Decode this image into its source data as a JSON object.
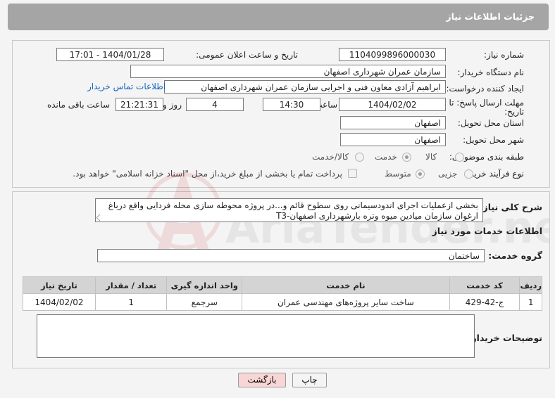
{
  "header": {
    "title": "جزئیات اطلاعات نیاز"
  },
  "form": {
    "need_number_label": "شماره نیاز:",
    "need_number": "1104099896000030",
    "announce_label": "تاریخ و ساعت اعلان عمومی:",
    "announce_value": "1404/01/28 - 17:01",
    "buyer_org_label": "نام دستگاه خریدار:",
    "buyer_org": "سازمان عمران شهرداری اصفهان",
    "creator_label": "ایجاد کننده درخواست:",
    "creator": "ابراهیم آزادی معاون فنی و اجرایی سازمان عمران شهرداری اصفهان",
    "contact_link": "اطلاعات تماس خریدار",
    "deadline_label_1": "مهلت ارسال پاسخ: تا",
    "deadline_label_2": "تاریخ:",
    "deadline_date": "1404/02/02",
    "time_label": "ساعت",
    "deadline_time": "14:30",
    "days_value": "4",
    "days_label": "روز و",
    "remaining_time": "21:21:31",
    "remaining_label": "ساعت باقی مانده",
    "province_label": "استان محل تحویل:",
    "province": "اصفهان",
    "city_label": "شهر محل تحویل:",
    "city": "اصفهان",
    "category_label": "طبقه بندی موضوعی:",
    "category_options": [
      "کالا",
      "خدمت",
      "کالا/خدمت"
    ],
    "category_selected": "خدمت",
    "process_label": "نوع فرآیند خرید :",
    "process_options": [
      "جزیی",
      "متوسط"
    ],
    "process_selected": "متوسط",
    "payment_note": "پرداخت تمام یا بخشی از مبلغ خرید،از محل \"اسناد خزانه اسلامی\" خواهد بود."
  },
  "description": {
    "label": "شرح کلی نیاز:",
    "line1": "بخشی ازعملیات اجرای اندودسیمانی روی سطوح قائم و...در پروژه محوطه سازی محله فردایی واقع درباغ",
    "line2": "ارغوان سازمان میادین میوه وتره بارشهرداری اصفهان-T3"
  },
  "services": {
    "section_title": "اطلاعات خدمات مورد نیاز",
    "group_label": "گروه خدمت:",
    "group_value": "ساختمان",
    "columns": [
      "ردیف",
      "کد خدمت",
      "نام خدمت",
      "واحد اندازه گیری",
      "تعداد / مقدار",
      "تاریخ نیاز"
    ],
    "rows": [
      [
        "1",
        "ج-42-429",
        "ساخت سایر پروژه‌های مهندسی عمران",
        "سرجمع",
        "1",
        "1404/02/02"
      ]
    ]
  },
  "buyer_notes": {
    "label": "توضیحات خریدار:",
    "value": ""
  },
  "buttons": {
    "print": "چاپ",
    "back": "بازگشت"
  },
  "watermark": {
    "text": "AriaTender.neT"
  },
  "colors": {
    "header_bg": "#a5a5a5",
    "link": "#1565c0",
    "back_button_bg": "#f9d6d6"
  }
}
